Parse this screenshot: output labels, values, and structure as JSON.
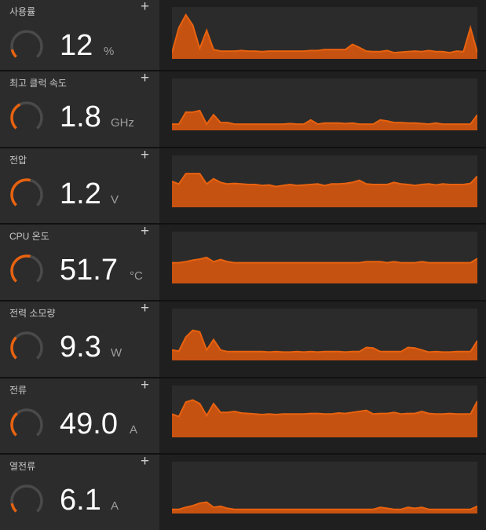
{
  "accent_color": "#e8620f",
  "fill_color": "#c65211",
  "icons": {
    "add": "plus-icon"
  },
  "metrics": [
    {
      "id": "usage",
      "label": "사용률",
      "value": "12",
      "unit": "%",
      "gauge_fraction": 0.12,
      "history": [
        0.12,
        0.6,
        0.85,
        0.65,
        0.2,
        0.55,
        0.18,
        0.15,
        0.15,
        0.15,
        0.16,
        0.15,
        0.15,
        0.14,
        0.15,
        0.15,
        0.15,
        0.15,
        0.15,
        0.15,
        0.16,
        0.16,
        0.18,
        0.18,
        0.18,
        0.18,
        0.28,
        0.22,
        0.15,
        0.14,
        0.14,
        0.16,
        0.12,
        0.13,
        0.14,
        0.15,
        0.14,
        0.16,
        0.14,
        0.14,
        0.12,
        0.15,
        0.14,
        0.6,
        0.12
      ]
    },
    {
      "id": "clock",
      "label": "최고 클럭 속도",
      "value": "1.8",
      "unit": "GHz",
      "gauge_fraction": 0.4,
      "history": [
        0.12,
        0.12,
        0.35,
        0.35,
        0.38,
        0.12,
        0.3,
        0.15,
        0.15,
        0.12,
        0.12,
        0.12,
        0.12,
        0.12,
        0.12,
        0.12,
        0.12,
        0.13,
        0.12,
        0.12,
        0.2,
        0.12,
        0.14,
        0.14,
        0.14,
        0.13,
        0.14,
        0.12,
        0.12,
        0.12,
        0.2,
        0.18,
        0.15,
        0.15,
        0.14,
        0.14,
        0.13,
        0.12,
        0.14,
        0.12,
        0.12,
        0.12,
        0.12,
        0.12,
        0.3
      ]
    },
    {
      "id": "voltage",
      "label": "전압",
      "value": "1.2",
      "unit": "V",
      "gauge_fraction": 0.55,
      "history": [
        0.5,
        0.45,
        0.65,
        0.65,
        0.65,
        0.45,
        0.55,
        0.48,
        0.45,
        0.46,
        0.45,
        0.44,
        0.44,
        0.42,
        0.43,
        0.4,
        0.42,
        0.44,
        0.42,
        0.43,
        0.44,
        0.45,
        0.42,
        0.45,
        0.45,
        0.46,
        0.48,
        0.52,
        0.45,
        0.44,
        0.44,
        0.44,
        0.48,
        0.45,
        0.44,
        0.42,
        0.44,
        0.45,
        0.43,
        0.45,
        0.44,
        0.44,
        0.44,
        0.46,
        0.6
      ]
    },
    {
      "id": "cpu-temp",
      "label": "CPU 온도",
      "value": "51.7",
      "unit": "°C",
      "gauge_fraction": 0.55,
      "history": [
        0.4,
        0.4,
        0.42,
        0.45,
        0.47,
        0.5,
        0.42,
        0.46,
        0.42,
        0.4,
        0.4,
        0.4,
        0.4,
        0.4,
        0.4,
        0.4,
        0.4,
        0.4,
        0.4,
        0.4,
        0.4,
        0.4,
        0.4,
        0.4,
        0.4,
        0.4,
        0.4,
        0.4,
        0.42,
        0.42,
        0.42,
        0.4,
        0.42,
        0.4,
        0.4,
        0.4,
        0.42,
        0.4,
        0.4,
        0.4,
        0.4,
        0.4,
        0.4,
        0.4,
        0.48
      ]
    },
    {
      "id": "power",
      "label": "전력 소모량",
      "value": "9.3",
      "unit": "W",
      "gauge_fraction": 0.33,
      "history": [
        0.2,
        0.18,
        0.45,
        0.58,
        0.55,
        0.2,
        0.4,
        0.2,
        0.17,
        0.17,
        0.17,
        0.17,
        0.17,
        0.17,
        0.16,
        0.17,
        0.16,
        0.16,
        0.17,
        0.16,
        0.17,
        0.16,
        0.17,
        0.17,
        0.17,
        0.16,
        0.17,
        0.17,
        0.25,
        0.24,
        0.17,
        0.17,
        0.17,
        0.17,
        0.25,
        0.24,
        0.2,
        0.16,
        0.17,
        0.16,
        0.16,
        0.17,
        0.17,
        0.17,
        0.38
      ]
    },
    {
      "id": "current",
      "label": "전류",
      "value": "49.0",
      "unit": "A",
      "gauge_fraction": 0.35,
      "history": [
        0.45,
        0.4,
        0.68,
        0.72,
        0.65,
        0.42,
        0.65,
        0.48,
        0.48,
        0.5,
        0.47,
        0.46,
        0.45,
        0.44,
        0.45,
        0.44,
        0.45,
        0.45,
        0.45,
        0.45,
        0.46,
        0.46,
        0.45,
        0.45,
        0.47,
        0.46,
        0.48,
        0.5,
        0.52,
        0.45,
        0.46,
        0.46,
        0.48,
        0.45,
        0.46,
        0.46,
        0.5,
        0.46,
        0.45,
        0.45,
        0.46,
        0.45,
        0.45,
        0.45,
        0.7
      ]
    },
    {
      "id": "thermal-current",
      "label": "열전류",
      "value": "6.1",
      "unit": "A",
      "gauge_fraction": 0.13,
      "history": [
        0.08,
        0.08,
        0.12,
        0.15,
        0.2,
        0.22,
        0.12,
        0.14,
        0.1,
        0.08,
        0.08,
        0.08,
        0.08,
        0.08,
        0.08,
        0.08,
        0.08,
        0.08,
        0.08,
        0.08,
        0.08,
        0.08,
        0.08,
        0.08,
        0.08,
        0.08,
        0.08,
        0.08,
        0.08,
        0.08,
        0.12,
        0.1,
        0.08,
        0.08,
        0.12,
        0.1,
        0.12,
        0.08,
        0.08,
        0.08,
        0.08,
        0.08,
        0.08,
        0.08,
        0.14
      ]
    }
  ]
}
